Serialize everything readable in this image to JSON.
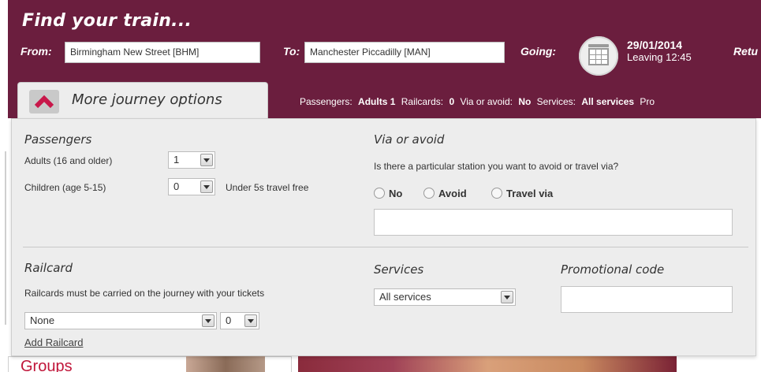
{
  "header": {
    "title": "Find your train...",
    "from_label": "From:",
    "from_value": "Birmingham New Street [BHM]",
    "to_label": "To:",
    "to_value": "Manchester Piccadilly [MAN]",
    "going_label": "Going:",
    "date": "29/01/2014",
    "leaving": "Leaving 12:45",
    "return_label": "Retu"
  },
  "tab": {
    "label": "More journey options",
    "icon": "chevron-up-icon"
  },
  "summary": {
    "passengers_label": "Passengers:",
    "passengers_value": "Adults 1",
    "railcards_label": "Railcards:",
    "railcards_value": "0",
    "via_label": "Via or avoid:",
    "via_value": "No",
    "services_label": "Services:",
    "services_value": "All services",
    "promo_label": "Pro"
  },
  "passengers": {
    "heading": "Passengers",
    "adults_label": "Adults (16 and older)",
    "adults_value": "1",
    "children_label": "Children (age 5-15)",
    "children_value": "0",
    "children_note": "Under 5s travel free"
  },
  "via": {
    "heading": "Via or avoid",
    "question": "Is there a particular station you want to avoid or travel via?",
    "options": [
      "No",
      "Avoid",
      "Travel via"
    ]
  },
  "railcard": {
    "heading": "Railcard",
    "note": "Railcards must be carried on the journey with your tickets",
    "type_value": "None",
    "count_value": "0",
    "add_link": "Add Railcard"
  },
  "services": {
    "heading": "Services",
    "value": "All services"
  },
  "promo": {
    "heading": "Promotional code",
    "value": ""
  },
  "background": {
    "groups_text": "Groups"
  },
  "colors": {
    "brand": "#6b1e3e",
    "accent_red": "#c0163a",
    "panel": "#ededed"
  }
}
